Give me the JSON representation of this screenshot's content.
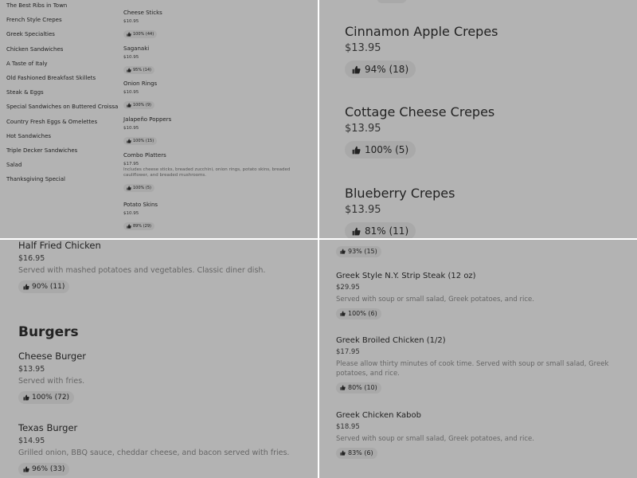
{
  "top_left": {
    "categories": [
      "The Best Ribs in Town",
      "French Style Crepes",
      "Greek Specialties",
      "Chicken Sandwiches",
      "A Taste of Italy",
      "Old Fashioned Breakfast Skillets",
      "Steak & Eggs",
      "Special Sandwiches on Buttered Croissa",
      "Country Fresh Eggs & Omelettes",
      "Hot Sandwiches",
      "Triple Decker Sandwiches",
      "Salad",
      "Thanksgiving Special"
    ],
    "items": [
      {
        "name": "Cheese Sticks",
        "price": "$10.95",
        "rating": "100% (44)"
      },
      {
        "name": "Saganaki",
        "price": "$10.95",
        "rating": "95% (14)"
      },
      {
        "name": "Onion Rings",
        "price": "$10.95",
        "rating": "100% (9)"
      },
      {
        "name": "Jalapeño Poppers",
        "price": "$10.95",
        "rating": "100% (15)"
      },
      {
        "name": "Combo Platters",
        "price": "$17.95",
        "desc": "Includes cheese sticks, breaded zucchini, onion rings, potato skins, breaded cauliflower, and breaded mushrooms.",
        "rating": "100% (5)"
      },
      {
        "name": "Potato Skins",
        "price": "$10.95",
        "rating": "89% (29)"
      }
    ]
  },
  "top_right": {
    "items": [
      {
        "name": "Cinnamon Apple Crepes",
        "price": "$13.95",
        "rating": "94% (18)"
      },
      {
        "name": "Cottage Cheese Crepes",
        "price": "$13.95",
        "rating": "100% (5)"
      },
      {
        "name": "Blueberry Crepes",
        "price": "$13.95",
        "rating": "81% (11)"
      }
    ]
  },
  "bottom_left": {
    "items": [
      {
        "name": "Half Fried Chicken",
        "price": "$16.95",
        "desc": "Served with mashed potatoes and vegetables. Classic diner dish.",
        "rating": "90% (11)"
      },
      {
        "name": "Cheese Burger",
        "price": "$13.95",
        "desc": "Served with fries.",
        "rating": "100% (72)"
      },
      {
        "name": "Texas Burger",
        "price": "$14.95",
        "desc": "Grilled onion, BBQ sauce, cheddar cheese, and bacon served with fries.",
        "rating": "96% (33)"
      }
    ],
    "section_heading": "Burgers"
  },
  "bottom_right": {
    "top_rating": "93% (15)",
    "items": [
      {
        "name": "Greek Style N.Y. Strip Steak (12 oz)",
        "price": "$29.95",
        "desc": "Served with soup or small salad, Greek potatoes, and rice.",
        "rating": "100% (6)"
      },
      {
        "name": "Greek Broiled Chicken (1/2)",
        "price": "$17.95",
        "desc": "Please allow thirty minutes of cook time. Served with soup or small salad, Greek potatoes, and rice.",
        "rating": "80% (10)"
      },
      {
        "name": "Greek Chicken Kabob",
        "price": "$18.95",
        "desc": "Served with soup or small salad, Greek potatoes, and rice.",
        "rating": "83% (6)"
      }
    ]
  }
}
